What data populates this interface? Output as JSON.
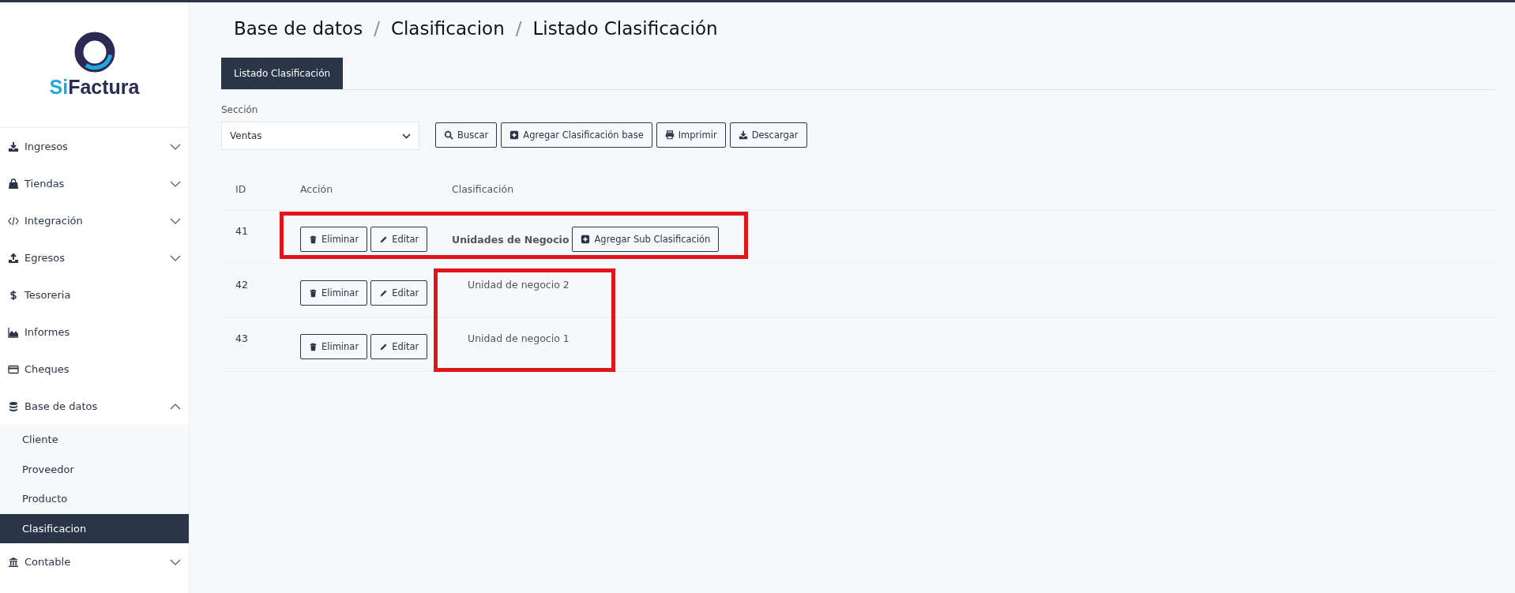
{
  "logo": {
    "text_accent": "Si",
    "text": "Factura"
  },
  "sidebar": {
    "items": [
      {
        "kind": "group",
        "label": "Ingresos",
        "expanded": false
      },
      {
        "kind": "group",
        "label": "Tiendas",
        "expanded": false
      },
      {
        "kind": "group",
        "label": "Integración",
        "expanded": false
      },
      {
        "kind": "group",
        "label": "Egresos",
        "expanded": false
      },
      {
        "kind": "link",
        "label": "Tesoreria"
      },
      {
        "kind": "link",
        "label": "Informes"
      },
      {
        "kind": "link",
        "label": "Cheques"
      },
      {
        "kind": "group",
        "label": "Base de datos",
        "expanded": true,
        "children": [
          {
            "label": "Cliente",
            "selected": false
          },
          {
            "label": "Proveedor",
            "selected": false
          },
          {
            "label": "Producto",
            "selected": false
          },
          {
            "label": "Clasificacion",
            "selected": true
          }
        ]
      },
      {
        "kind": "group",
        "label": "Contable",
        "expanded": false
      }
    ]
  },
  "breadcrumb": [
    "Base de datos",
    "Clasificacion",
    "Listado Clasificación"
  ],
  "breadcrumb_separator": "/",
  "tabs": [
    {
      "label": "Listado Clasificación",
      "selected": true
    }
  ],
  "filter": {
    "label": "Sección",
    "value": "Ventas"
  },
  "toolbar": [
    {
      "label": "Buscar"
    },
    {
      "label": "Agregar Clasificación base"
    },
    {
      "label": "Imprimir"
    },
    {
      "label": "Descargar"
    }
  ],
  "table": {
    "columns": [
      "ID",
      "Acción",
      "Clasificación"
    ],
    "rows": [
      {
        "kind": "parent",
        "id": "41",
        "actions": [
          "Eliminar",
          "Editar"
        ],
        "name": "Unidades de Negocio",
        "add_label": "Agregar Sub Clasificación"
      },
      {
        "kind": "child",
        "id": "42",
        "actions": [
          "Eliminar",
          "Editar"
        ],
        "name": "Unidad de negocio 2"
      },
      {
        "kind": "child",
        "id": "43",
        "actions": [
          "Eliminar",
          "Editar"
        ],
        "name": "Unidad de negocio 1"
      }
    ]
  }
}
